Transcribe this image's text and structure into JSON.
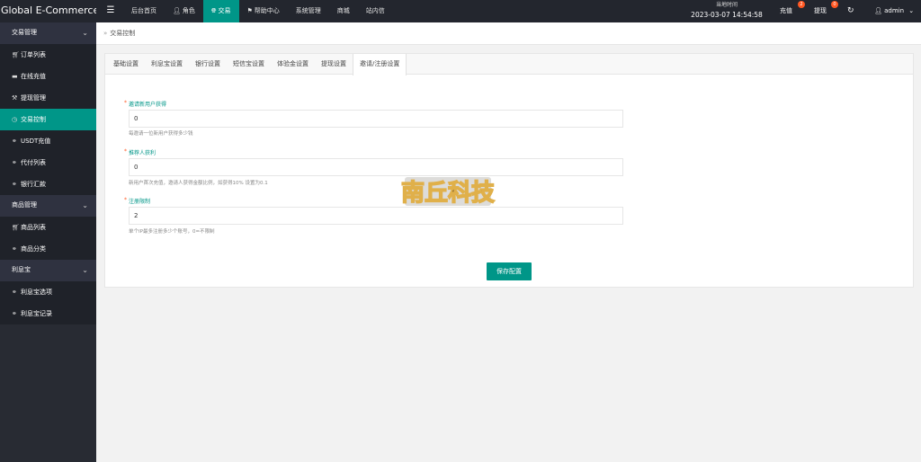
{
  "header": {
    "brand": "Global E-Commerce...",
    "menu_toggle": "☰",
    "nav": [
      {
        "label": "后台首页",
        "icon": ""
      },
      {
        "label": "角色",
        "icon": "user-icon"
      },
      {
        "label": "交易",
        "icon": "globe-icon",
        "active": true
      },
      {
        "label": "帮助中心",
        "icon": "flag-icon"
      },
      {
        "label": "系统管理",
        "icon": ""
      },
      {
        "label": "商城",
        "icon": ""
      },
      {
        "label": "站内信",
        "icon": ""
      }
    ],
    "time_label": "当地时间",
    "time_value": "2023-03-07 14:54:58",
    "recharge_label": "充值",
    "recharge_badge": "2",
    "withdraw_label": "提现",
    "withdraw_badge": "0",
    "refresh_icon": "refresh-icon",
    "user_label": "admin"
  },
  "sidebar": {
    "groups": [
      {
        "label": "交易管理",
        "items": [
          {
            "label": "订单列表",
            "icon": "cart-icon"
          },
          {
            "label": "在线充值",
            "icon": "chat-icon"
          },
          {
            "label": "提现管理",
            "icon": "gavel-icon"
          },
          {
            "label": "交易控制",
            "icon": "dashboard-icon",
            "active": true
          },
          {
            "label": "USDT充值",
            "icon": "link-icon"
          },
          {
            "label": "代付列表",
            "icon": "link-icon"
          },
          {
            "label": "银行汇款",
            "icon": "link-icon"
          }
        ]
      },
      {
        "label": "商品管理",
        "items": [
          {
            "label": "商品列表",
            "icon": "cart-icon"
          },
          {
            "label": "商品分类",
            "icon": "link-icon"
          }
        ]
      },
      {
        "label": "利息宝",
        "items": [
          {
            "label": "利息宝选项",
            "icon": "link-icon"
          },
          {
            "label": "利息宝记录",
            "icon": "link-icon"
          }
        ]
      }
    ]
  },
  "breadcrumb": {
    "separator": "»",
    "label": "交易控制"
  },
  "tabs": [
    "基础设置",
    "利息宝设置",
    "银行设置",
    "短信宝设置",
    "体验金设置",
    "提现设置",
    "邀请/注册设置"
  ],
  "active_tab": "邀请/注册设置",
  "form": {
    "fields": [
      {
        "label": "邀请新用户获得",
        "value": "0",
        "help": "每邀请一位新用户获得多少钱"
      },
      {
        "label": "推荐人获利",
        "value": "0",
        "help": "新用户首次充值，邀请人获得金额比例，如获得10% 设置为0.1"
      },
      {
        "label": "注册限制",
        "value": "2",
        "help": "单个IP最多注册多少个账号，0=不限制"
      }
    ],
    "save_label": "保存配置"
  },
  "watermark": {
    "text": "南丘科技"
  },
  "colors": {
    "accent": "#009688",
    "topbar": "#23262e",
    "sidebar": "#282b33",
    "badge": "#ff5722"
  }
}
